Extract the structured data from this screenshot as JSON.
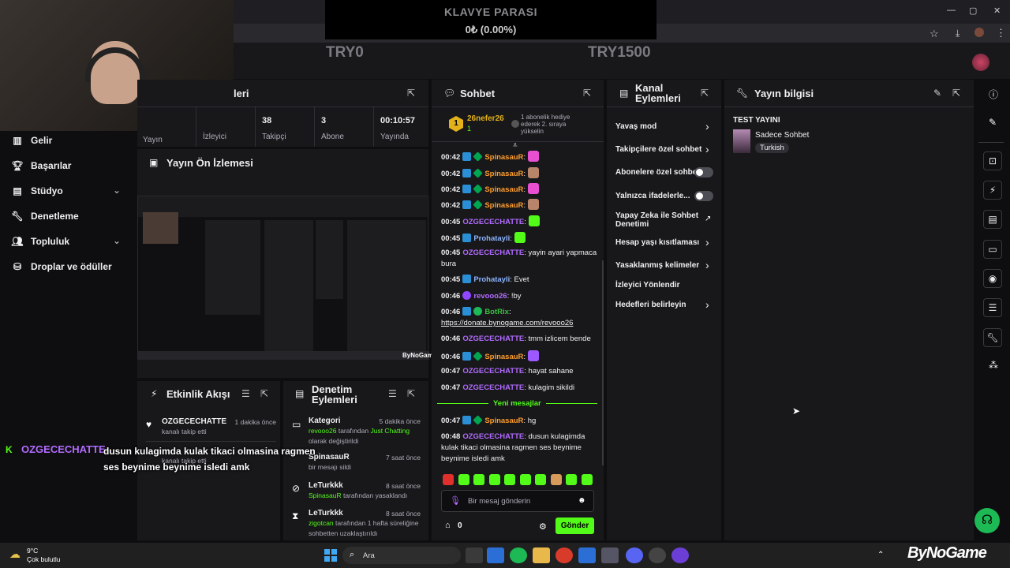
{
  "window": {
    "minimize": "—",
    "maximize": "▢",
    "close": "✕"
  },
  "goal": {
    "title": "KLAVYE PARASI",
    "value": "0₺ (0.00%)",
    "start": "TRY0",
    "end": "TRY1500"
  },
  "stats": {
    "heading": "leri",
    "items": [
      {
        "value": "",
        "label": "Yayın"
      },
      {
        "value": "",
        "label": "İzleyici"
      },
      {
        "value": "38",
        "label": "Takipçi"
      },
      {
        "value": "3",
        "label": "Abone"
      },
      {
        "value": "00:10:57",
        "label": "Yayında"
      }
    ]
  },
  "nav": {
    "items": [
      {
        "label": "Gelir",
        "icon": "chart-icon"
      },
      {
        "label": "Başarılar",
        "icon": "trophy-icon"
      },
      {
        "label": "Stüdyo",
        "icon": "studio-icon"
      },
      {
        "label": "Denetleme",
        "icon": "wrench-icon"
      },
      {
        "label": "Topluluk",
        "icon": "community-icon"
      },
      {
        "label": "Droplar ve ödüller",
        "icon": "drops-icon"
      }
    ]
  },
  "preview": {
    "title": "Yayın Ön İzlemesi",
    "watermark": "ByNoGame"
  },
  "chat": {
    "title": "Sohbet",
    "pinned": {
      "user": "26nefer26",
      "level": "1",
      "count": "1",
      "note": "1 abonelik hediye ederek 2. sıraya yükselin"
    },
    "messages": [
      {
        "time": "00:42",
        "user": "SpinasauR",
        "text": ""
      },
      {
        "time": "00:42",
        "user": "SpinasauR",
        "text": ""
      },
      {
        "time": "00:42",
        "user": "SpinasauR",
        "text": ""
      },
      {
        "time": "00:42",
        "user": "SpinasauR",
        "text": ""
      },
      {
        "time": "00:45",
        "user": "OZGECECHATTE",
        "text": ""
      },
      {
        "time": "00:45",
        "user": "Prohatayli",
        "text": ""
      },
      {
        "time": "00:45",
        "user": "OZGECECHATTE",
        "text": "yayin ayari yapmaca bura"
      },
      {
        "time": "00:45",
        "user": "Prohatayli",
        "text": "Evet"
      },
      {
        "time": "00:46",
        "user": "revooo26",
        "text": "!by"
      },
      {
        "time": "00:46",
        "user": "BotRix",
        "text": "https://donate.bynogame.com/revooo26"
      },
      {
        "time": "00:46",
        "user": "OZGECECHATTE",
        "text": "tmm izlicem bende"
      },
      {
        "time": "00:46",
        "user": "SpinasauR",
        "text": ""
      },
      {
        "time": "00:47",
        "user": "OZGECECHATTE",
        "text": "hayat sahane"
      },
      {
        "time": "00:47",
        "user": "OZGECECHATTE",
        "text": "kulagim sikildi"
      },
      {
        "time": "00:47",
        "user": "SpinasauR",
        "text": "hg"
      },
      {
        "time": "00:48",
        "user": "OZGECECHATTE",
        "text": "dusun kulagimda kulak tikaci olmasina ragmen ses beynime beynime isledi amk"
      }
    ],
    "new_messages": "Yeni mesajlar",
    "input_placeholder": "Bir mesaj gönderin",
    "points": "0",
    "send": "Gönder"
  },
  "channel_actions": {
    "title": "Kanal Eylemleri",
    "items": [
      "Yavaş mod",
      "Takipçilere özel sohbet",
      "Abonelere özel sohbet",
      "Yalnızca ifadelerle...",
      "Yapay Zeka ile Sohbet Denetimi",
      "Hesap yaşı kısıtlaması",
      "Yasaklanmış kelimeler",
      "İzleyici Yönlendir",
      "Hedefleri belirleyin"
    ]
  },
  "stream_info": {
    "title": "Yayın bilgisi",
    "stream_title": "TEST YAYINI",
    "category": "Sadece Sohbet",
    "tag": "Turkish"
  },
  "activity": {
    "title": "Etkinlik Akışı",
    "items": [
      {
        "user": "OZGECECHATTE",
        "time": "1 dakika önce",
        "desc": "kanalı takip etti"
      },
      {
        "user": "",
        "time": "",
        "desc": "kanalı takip etti"
      }
    ]
  },
  "mod_actions": {
    "title": "Denetim Eylemleri",
    "items": [
      {
        "title": "Kategori",
        "time": "5 dakika önce",
        "actor": "revooo26",
        "mid": "tarafından",
        "target": "Just Chatting",
        "rest": "olarak değiştirildi"
      },
      {
        "title": "SpinasauR",
        "time": "7 saat önce",
        "actor": "",
        "mid": "",
        "target": "",
        "rest": "bir mesajı sildi"
      },
      {
        "title": "LeTurkkk",
        "time": "8 saat önce",
        "actor": "SpinasauR",
        "mid": "tarafından yasaklandı",
        "target": "",
        "rest": ""
      },
      {
        "title": "LeTurkkk",
        "time": "8 saat önce",
        "actor": "zigotcan",
        "mid": "tarafından 1 hafta süreliğine sohbetten uzaklaştırıldı",
        "target": "",
        "rest": ""
      }
    ]
  },
  "overlay": {
    "user": "OZGECECHATTE",
    "text": "dusun kulagimda kulak tikaci olmasina ragmen ses beynime beynime isledi amk"
  },
  "taskbar": {
    "weather_temp": "9°C",
    "weather_desc": "Çok bulutlu",
    "search": "Ara"
  },
  "brand": {
    "logo_text": "ByNoGame"
  },
  "colors": {
    "accent": "#53fc18",
    "bg": "#0e0e10",
    "panel": "#18181b",
    "purple": "#b26bff",
    "orange": "#ff9d2b"
  }
}
